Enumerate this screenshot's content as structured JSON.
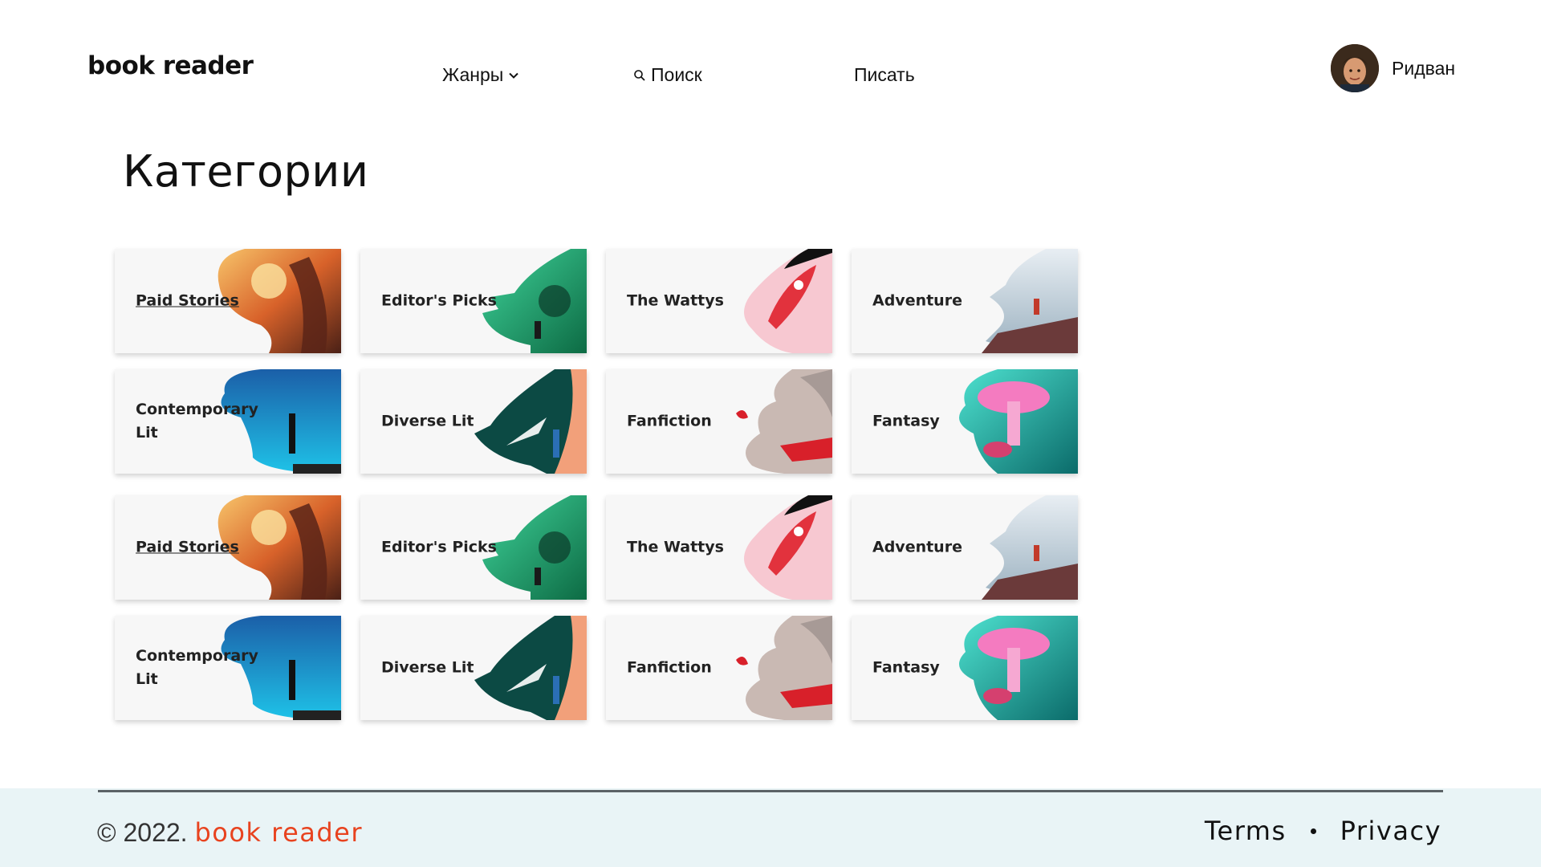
{
  "header": {
    "logo": "book reader",
    "nav": {
      "genres": "Жанры",
      "search": "Поиск",
      "write": "Писать"
    },
    "user": {
      "name": "Ридван"
    }
  },
  "main": {
    "title": "Категории",
    "cards": [
      {
        "label": "Paid Stories",
        "art": "fire-sunset"
      },
      {
        "label": "Editor's Picks",
        "art": "green-city"
      },
      {
        "label": "The Wattys",
        "art": "red-rocket"
      },
      {
        "label": "Adventure",
        "art": "mountain-cliff"
      },
      {
        "label": "Contemporary Lit",
        "art": "blue-sky"
      },
      {
        "label": "Diverse Lit",
        "art": "sparkle-night"
      },
      {
        "label": "Fanfiction",
        "art": "cloud-ship"
      },
      {
        "label": "Fantasy",
        "art": "pink-mushroom"
      },
      {
        "label": "Paid Stories",
        "art": "fire-sunset"
      },
      {
        "label": "Editor's Picks",
        "art": "green-city"
      },
      {
        "label": "The Wattys",
        "art": "red-rocket"
      },
      {
        "label": "Adventure",
        "art": "mountain-cliff"
      },
      {
        "label": "Contemporary Lit",
        "art": "blue-sky"
      },
      {
        "label": "Diverse Lit",
        "art": "sparkle-night"
      },
      {
        "label": "Fanfiction",
        "art": "cloud-ship"
      },
      {
        "label": "Fantasy",
        "art": "pink-mushroom"
      }
    ]
  },
  "footer": {
    "copyright": "© 2022.",
    "brand": "book reader",
    "terms": "Terms",
    "privacy": "Privacy"
  },
  "colors": {
    "brand_orange": "#e8431f",
    "footer_bg": "#e9f4f6",
    "card_bg": "#f7f7f7"
  }
}
